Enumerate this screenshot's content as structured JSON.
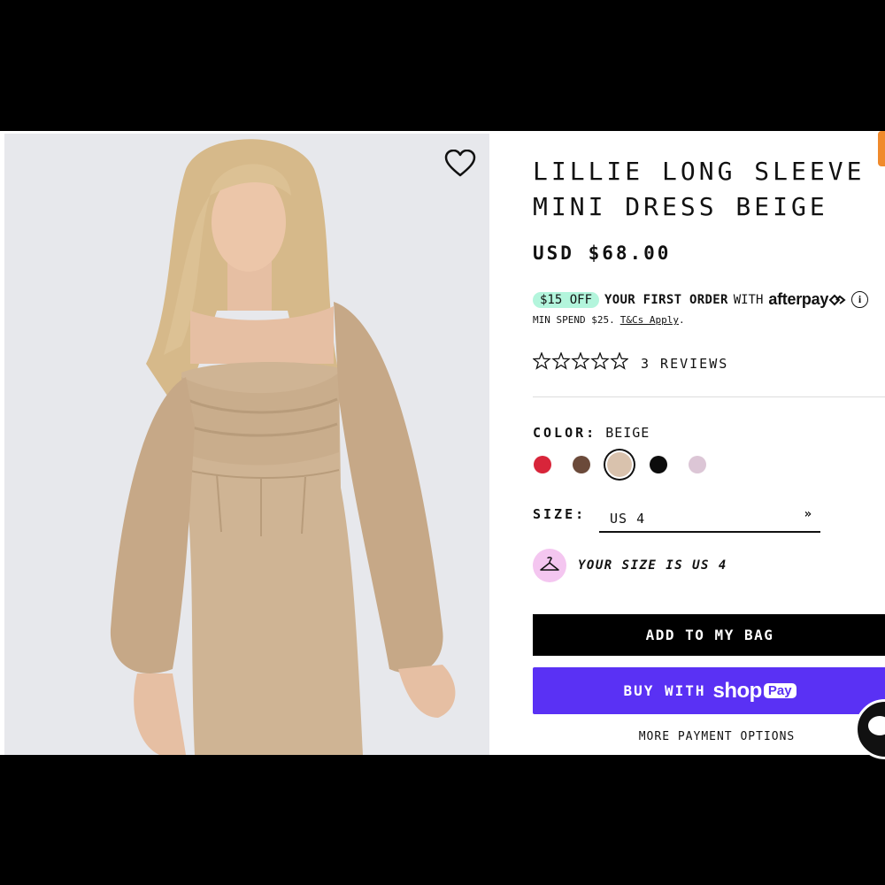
{
  "product": {
    "title_line1": "LILLIE LONG SLEEVE",
    "title_line2": "MINI DRESS BEIGE",
    "price": "USD $68.00"
  },
  "promo": {
    "badge": "$15 OFF",
    "text": "YOUR FIRST ORDER",
    "with": "WITH",
    "provider": "afterpay",
    "provider_icon": "afterpay-arrows-icon",
    "info_icon": "info-icon",
    "min_spend": "MIN SPEND $25.",
    "terms_link": "T&Cs Apply",
    "terms_suffix": "."
  },
  "rating": {
    "stars_filled": 0,
    "stars_total": 5,
    "reviews_label": "3 REVIEWS"
  },
  "color": {
    "label": "COLOR:",
    "selected": "BEIGE",
    "swatches": [
      {
        "name": "red",
        "hex": "#d8253a"
      },
      {
        "name": "brown",
        "hex": "#6b4a3a"
      },
      {
        "name": "beige",
        "hex": "#d9c2ad",
        "selected": true
      },
      {
        "name": "black",
        "hex": "#0c0c0c"
      },
      {
        "name": "lilac",
        "hex": "#dcc6d6"
      }
    ]
  },
  "size": {
    "label": "SIZE:",
    "selected": "US 4",
    "fit_message": "YOUR SIZE IS US 4",
    "fit_icon": "hanger-icon"
  },
  "actions": {
    "add_to_bag": "ADD TO MY BAG",
    "buy_with": "BUY WITH",
    "shop": "shop",
    "pay": "Pay",
    "more_payment": "MORE PAYMENT OPTIONS"
  },
  "icons": {
    "wishlist": "heart-icon",
    "chat": "chat-icon"
  },
  "colors": {
    "promo_badge": "#b3f5dc",
    "shop_pay": "#5a31f4",
    "fit_circle": "#f4c6f0",
    "photo_bg": "#e7e8ec",
    "dress": "#cfb494"
  }
}
